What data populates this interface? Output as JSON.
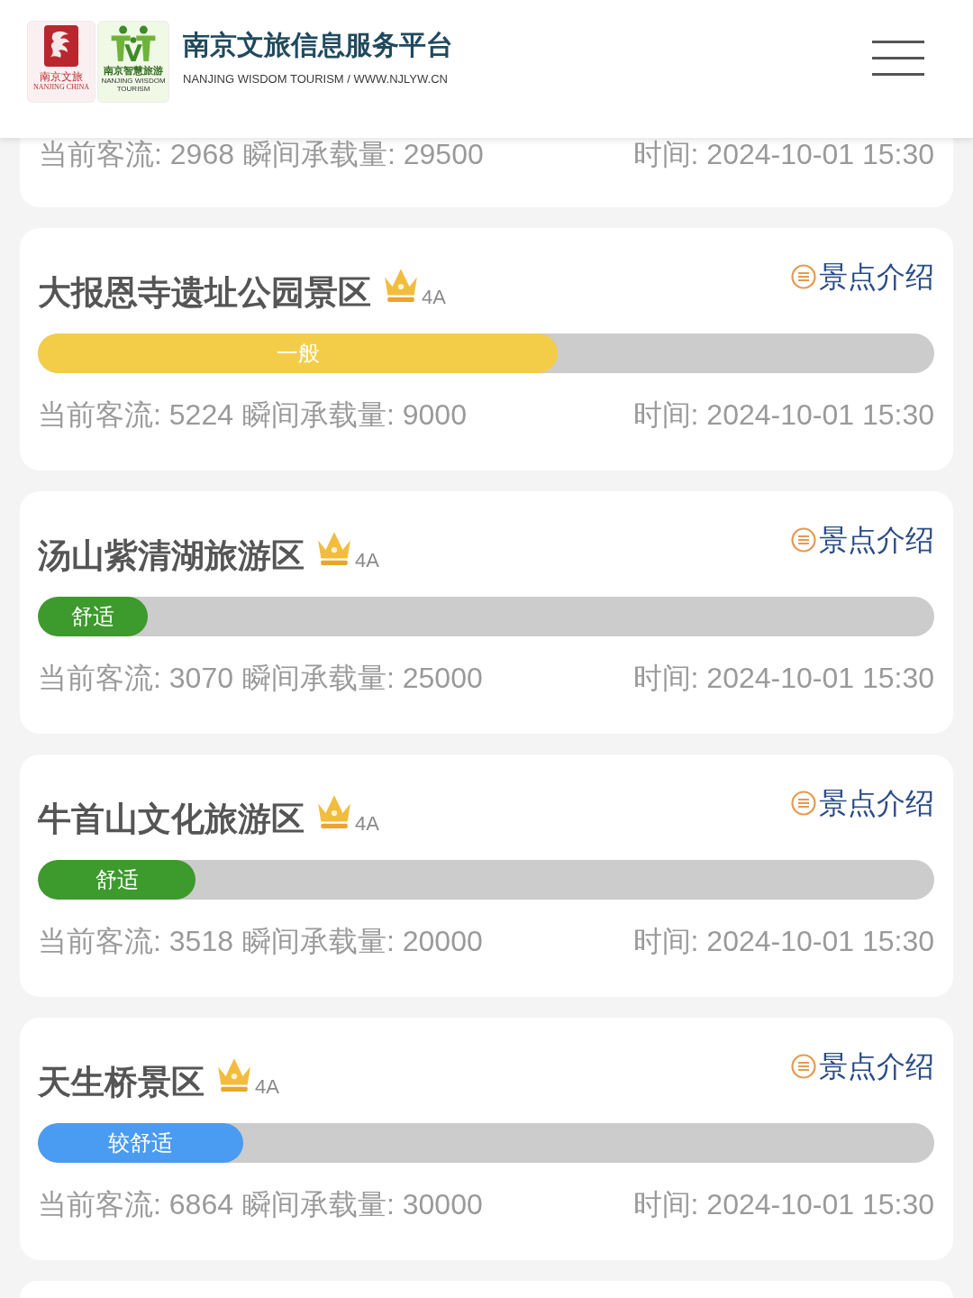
{
  "header": {
    "logo": {
      "seal_text": "南京文旅",
      "seal_caption": "NANJING CHINA",
      "brand_text": "南京智慧旅游",
      "brand_caption": "NANJING WISDOM TOURISM"
    },
    "title": "南京文旅信息服务平台",
    "subtitle": "NANJING WISDOM TOURISM / WWW.NJLYW.CN"
  },
  "spots": [
    {
      "kind": "tail",
      "flow": "当前客流: 2968",
      "capacity": "瞬间承载量: 29500",
      "time": "时间: 2024-10-01 15:30"
    },
    {
      "kind": "full",
      "name": "大报恩寺遗址公园景区",
      "rating": "4A",
      "intro": "景点介绍",
      "status": "一般",
      "level": 0.58,
      "color": "#f4cd48",
      "flow": "当前客流: 5224",
      "capacity": "瞬间承载量: 9000",
      "time": "时间: 2024-10-01 15:30"
    },
    {
      "kind": "full",
      "name": "汤山紫清湖旅游区",
      "rating": "4A",
      "intro": "景点介绍",
      "status": "舒适",
      "level": 0.123,
      "color": "#3d9a2c",
      "flow": "当前客流: 3070",
      "capacity": "瞬间承载量: 25000",
      "time": "时间: 2024-10-01 15:30"
    },
    {
      "kind": "full",
      "name": "牛首山文化旅游区",
      "rating": "4A",
      "intro": "景点介绍",
      "status": "舒适",
      "level": 0.176,
      "color": "#3d9a2c",
      "flow": "当前客流: 3518",
      "capacity": "瞬间承载量: 20000",
      "time": "时间: 2024-10-01 15:30"
    },
    {
      "kind": "full",
      "name": "天生桥景区",
      "rating": "4A",
      "intro": "景点介绍",
      "status": "较舒适",
      "level": 0.229,
      "color": "#4a9bf2",
      "flow": "当前客流: 6864",
      "capacity": "瞬间承载量: 30000",
      "time": "时间: 2024-10-01 15:30"
    },
    {
      "kind": "cut"
    }
  ]
}
